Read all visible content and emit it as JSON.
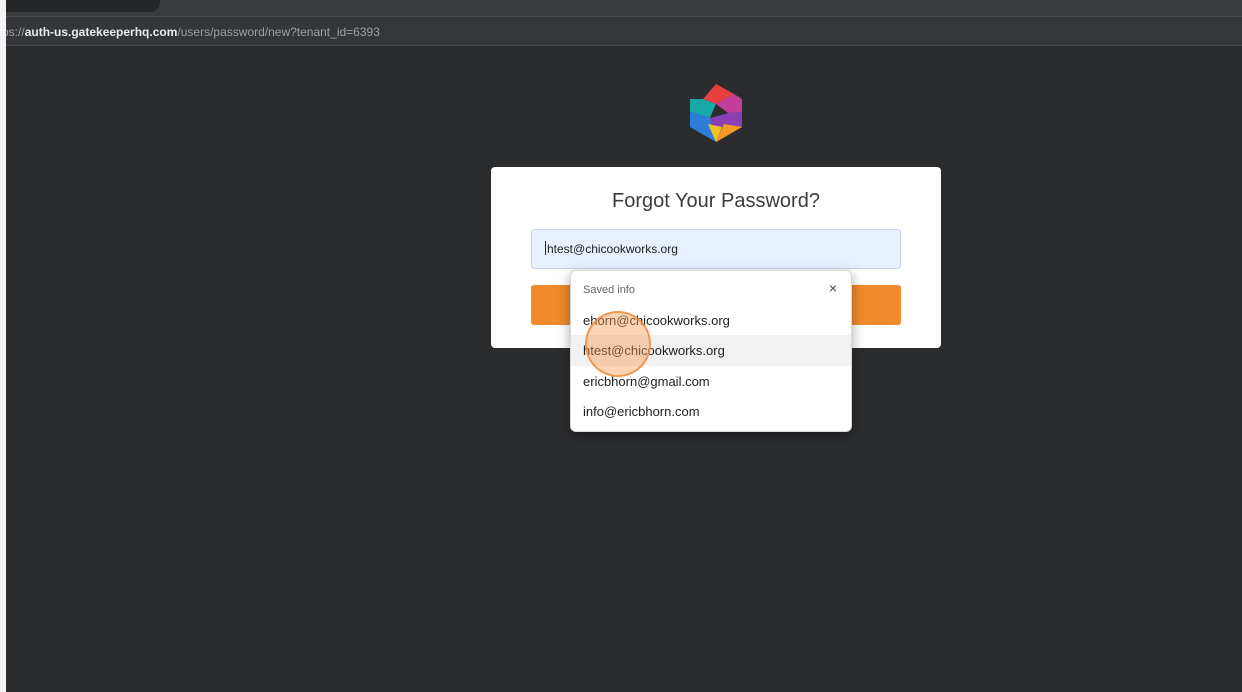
{
  "browser": {
    "url_prefix": "ps://",
    "url_host": "auth-us.gatekeeperhq.com",
    "url_path": "/users/password/new?tenant_id=6393"
  },
  "logo": {
    "icon": "gatekeeper-g-logo-icon"
  },
  "form": {
    "title": "Forgot Your Password?",
    "email_value": "htest@chicookworks.org",
    "submit_color": "#f08a2c"
  },
  "autofill": {
    "header": "Saved info",
    "close_icon": "×",
    "items": [
      "ehorn@chicookworks.org",
      "htest@chicookworks.org",
      "ericbhorn@gmail.com",
      "info@ericbhorn.com"
    ],
    "highlighted_index": 1
  },
  "colors": {
    "page_background": "#2b2c2e",
    "accent_orange": "#f08a2c",
    "autofill_background": "#e8f0fe"
  }
}
